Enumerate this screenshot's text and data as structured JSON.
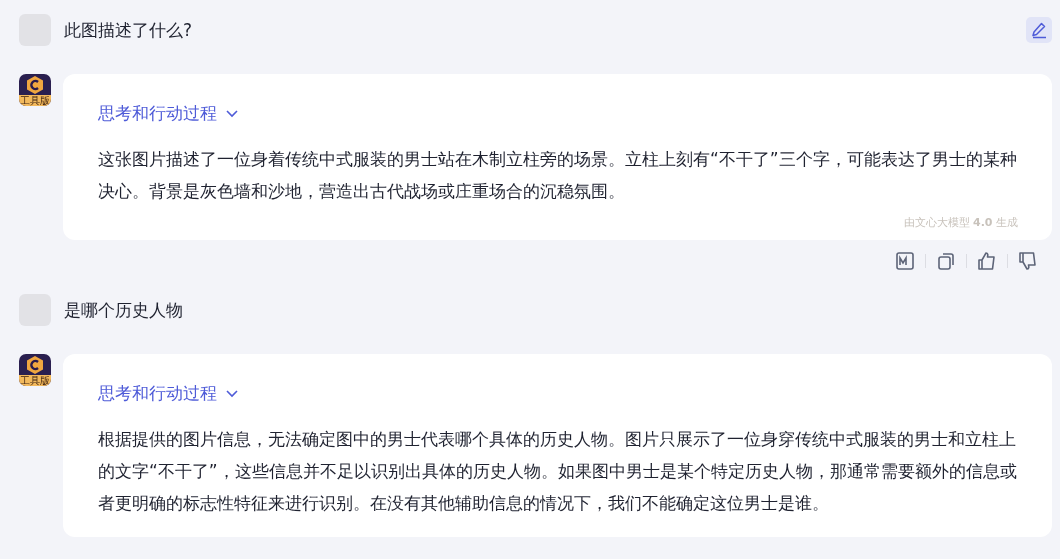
{
  "messages": [
    {
      "kind": "user",
      "text": "此图描述了什么?",
      "editable": true
    },
    {
      "kind": "bot",
      "badge": "工具版",
      "process_title": "思考和行动过程",
      "text": "这张图片描述了一位身着传统中式服装的男士站在木制立柱旁的场景。立柱上刻有“不干了”三个字，可能表达了男士的某种决心。背景是灰色墙和沙地，营造出古代战场或庄重场合的沉稳氛围。",
      "footnote": "由文心大模型 **4.0** 生成",
      "actions": true
    },
    {
      "kind": "user",
      "text": "是哪个历史人物",
      "editable": false
    },
    {
      "kind": "bot",
      "badge": "工具版",
      "process_title": "思考和行动过程",
      "text": "根据提供的图片信息，无法确定图中的男士代表哪个具体的历史人物。图片只展示了一位身穿传统中式服装的男士和立柱上的文字“不干了”，这些信息并不足以识别出具体的历史人物。如果图中男士是某个特定历史人物，那通常需要额外的信息或者更明确的标志性特征来进行识别。在没有其他辅助信息的情况下，我们不能确定这位男士是谁。",
      "actions": false
    }
  ]
}
